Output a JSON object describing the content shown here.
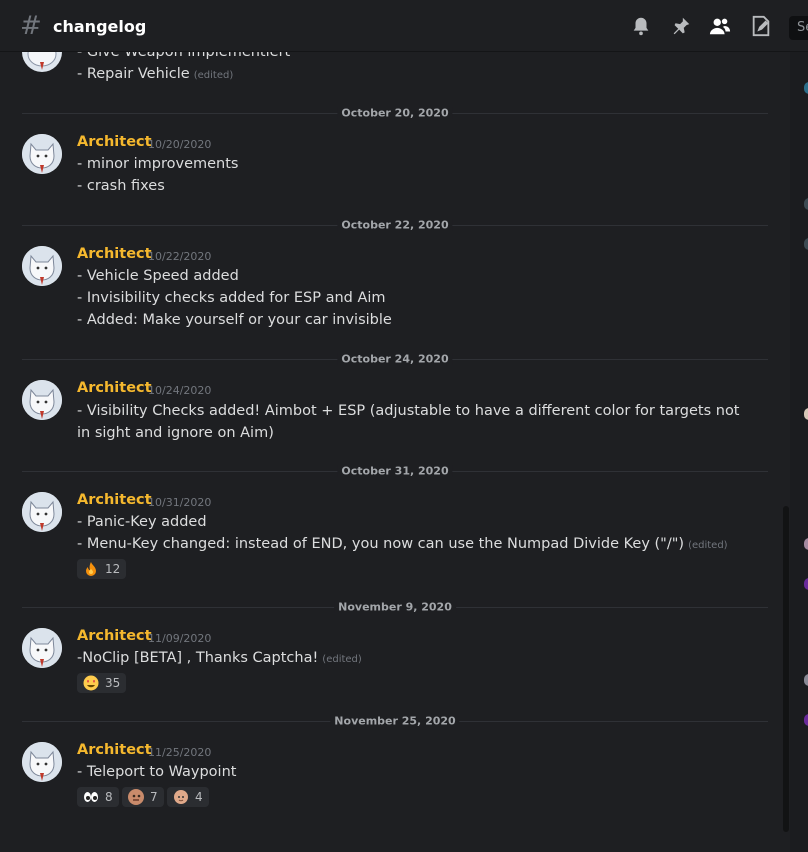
{
  "header": {
    "channel_name": "changelog",
    "search_placeholder": "Se"
  },
  "previous_message_lines": [
    "- Give Weapon implementiert",
    "- Repair Vehicle"
  ],
  "edited_label": "(edited)",
  "messages": [
    {
      "date": "October 20, 2020",
      "author": "Architect",
      "timestamp": "10/20/2020",
      "lines": [
        "- minor improvements",
        "- crash fixes"
      ]
    },
    {
      "date": "October 22, 2020",
      "author": "Architect",
      "timestamp": "10/22/2020",
      "lines": [
        "- Vehicle Speed added",
        "- Invisibility checks added for ESP and Aim",
        "- Added: Make yourself or your car invisible"
      ]
    },
    {
      "date": "October 24, 2020",
      "author": "Architect",
      "timestamp": "10/24/2020",
      "lines": [
        "- Visibility Checks added! Aimbot + ESP (adjustable to have a different color for targets not in sight and ignore on Aim)"
      ]
    },
    {
      "date": "October 31, 2020",
      "author": "Architect",
      "timestamp": "10/31/2020",
      "lines": [
        "- Panic-Key added",
        "- Menu-Key changed: instead of END, you now can use the Numpad Divide Key (\"/\")"
      ],
      "reactions": [
        {
          "emoji": "fire",
          "count": "12"
        }
      ]
    },
    {
      "date": "November 9, 2020",
      "author": "Architect",
      "timestamp": "11/09/2020",
      "lines": [
        "-NoClip [BETA] , Thanks Captcha!"
      ],
      "reactions": [
        {
          "emoji": "heart-eyes",
          "count": "35"
        }
      ]
    },
    {
      "date": "November 25, 2020",
      "author": "Architect",
      "timestamp": "11/25/2020",
      "lines": [
        "- Teleport to Waypoint"
      ],
      "reactions": [
        {
          "emoji": "eyes",
          "count": "8"
        },
        {
          "emoji": "face-custom",
          "count": "7"
        },
        {
          "emoji": "bald-head",
          "count": "4"
        }
      ]
    }
  ],
  "colors": {
    "background": "#1e1f22",
    "author": "#f5b82e",
    "text": "#dcddde",
    "muted": "#72767d"
  }
}
